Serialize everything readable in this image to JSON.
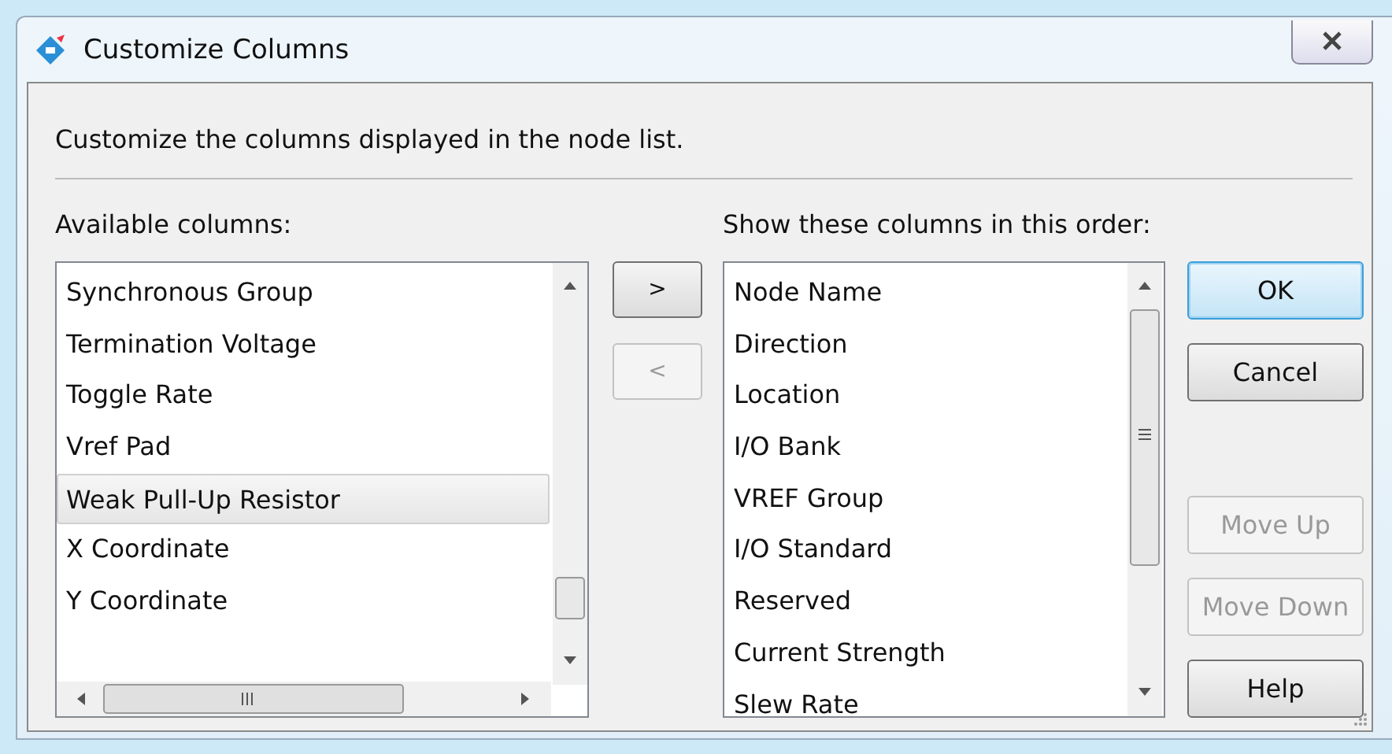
{
  "window": {
    "title": "Customize Columns"
  },
  "description": "Customize the columns displayed in the node list.",
  "available": {
    "label": "Available columns:",
    "items": [
      {
        "label": "Synchronous Group",
        "selected": false
      },
      {
        "label": "Termination Voltage",
        "selected": false
      },
      {
        "label": "Toggle Rate",
        "selected": false
      },
      {
        "label": "Vref Pad",
        "selected": false
      },
      {
        "label": "Weak Pull-Up Resistor",
        "selected": true
      },
      {
        "label": "X Coordinate",
        "selected": false
      },
      {
        "label": "Y Coordinate",
        "selected": false
      }
    ]
  },
  "move_buttons": [
    {
      "label": ">",
      "disabled": false
    },
    {
      "label": "<",
      "disabled": true
    }
  ],
  "shown": {
    "label": "Show these columns in this order:",
    "items": [
      {
        "label": "Node Name",
        "selected": false
      },
      {
        "label": "Direction",
        "selected": false
      },
      {
        "label": "Location",
        "selected": false
      },
      {
        "label": "I/O Bank",
        "selected": false
      },
      {
        "label": "VREF Group",
        "selected": false
      },
      {
        "label": "I/O Standard",
        "selected": false
      },
      {
        "label": "Reserved",
        "selected": false
      },
      {
        "label": "Current Strength",
        "selected": false
      },
      {
        "label": "Slew Rate",
        "selected": false
      }
    ]
  },
  "buttons": [
    {
      "label": "OK",
      "disabled": false,
      "default": true,
      "kind": "top"
    },
    {
      "label": "Cancel",
      "disabled": false,
      "default": false,
      "kind": "top"
    },
    {
      "label": "Move Up",
      "disabled": true,
      "default": false,
      "kind": "bottom"
    },
    {
      "label": "Move Down",
      "disabled": true,
      "default": false,
      "kind": "bottom"
    },
    {
      "label": "Help",
      "disabled": false,
      "default": false,
      "kind": "bottom"
    }
  ]
}
